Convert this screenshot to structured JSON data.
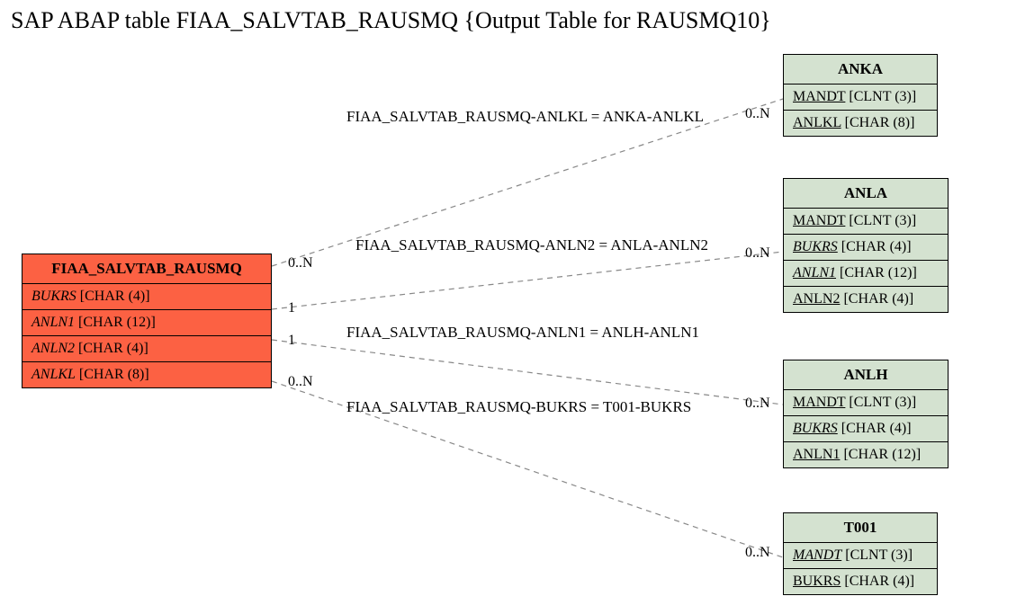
{
  "title": "SAP ABAP table FIAA_SALVTAB_RAUSMQ {Output Table for RAUSMQ10}",
  "main_entity": {
    "name": "FIAA_SALVTAB_RAUSMQ",
    "fields": [
      {
        "key": "BUKRS",
        "type": "[CHAR (4)]",
        "fk": true
      },
      {
        "key": "ANLN1",
        "type": "[CHAR (12)]",
        "fk": true
      },
      {
        "key": "ANLN2",
        "type": "[CHAR (4)]",
        "fk": true
      },
      {
        "key": "ANLKL",
        "type": "[CHAR (8)]",
        "fk": true
      }
    ]
  },
  "related": {
    "anka": {
      "name": "ANKA",
      "fields": [
        {
          "key": "MANDT",
          "type": "[CLNT (3)]"
        },
        {
          "key": "ANLKL",
          "type": "[CHAR (8)]"
        }
      ]
    },
    "anla": {
      "name": "ANLA",
      "fields": [
        {
          "key": "MANDT",
          "type": "[CLNT (3)]"
        },
        {
          "key": "BUKRS",
          "type": "[CHAR (4)]",
          "fk": true
        },
        {
          "key": "ANLN1",
          "type": "[CHAR (12)]",
          "fk": true
        },
        {
          "key": "ANLN2",
          "type": "[CHAR (4)]"
        }
      ]
    },
    "anlh": {
      "name": "ANLH",
      "fields": [
        {
          "key": "MANDT",
          "type": "[CLNT (3)]"
        },
        {
          "key": "BUKRS",
          "type": "[CHAR (4)]",
          "fk": true
        },
        {
          "key": "ANLN1",
          "type": "[CHAR (12)]"
        }
      ]
    },
    "t001": {
      "name": "T001",
      "fields": [
        {
          "key": "MANDT",
          "type": "[CLNT (3)]",
          "fk": true
        },
        {
          "key": "BUKRS",
          "type": "[CHAR (4)]"
        }
      ]
    }
  },
  "relations": {
    "r1": {
      "label": "FIAA_SALVTAB_RAUSMQ-ANLKL = ANKA-ANLKL",
      "left_card": "0..N",
      "right_card": "0..N"
    },
    "r2": {
      "label": "FIAA_SALVTAB_RAUSMQ-ANLN2 = ANLA-ANLN2",
      "left_card": "1",
      "right_card": "0..N"
    },
    "r3": {
      "label": "FIAA_SALVTAB_RAUSMQ-ANLN1 = ANLH-ANLN1",
      "left_card": "1",
      "right_card": "0..N"
    },
    "r4": {
      "label": "FIAA_SALVTAB_RAUSMQ-BUKRS = T001-BUKRS",
      "left_card": "0..N",
      "right_card": "0..N"
    }
  }
}
